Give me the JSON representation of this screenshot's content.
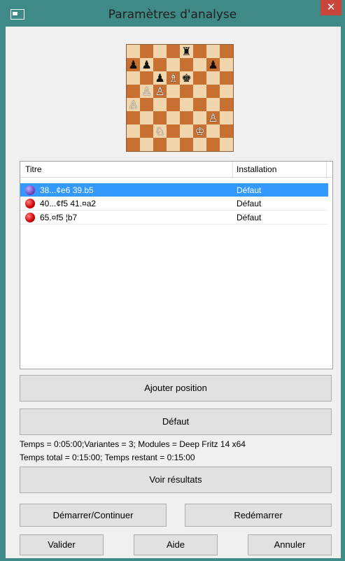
{
  "window": {
    "title": "Paramètres d'analyse",
    "close_glyph": "✕"
  },
  "board": {
    "rows": [
      [
        "",
        "",
        "",
        "",
        "♜",
        "",
        "",
        ""
      ],
      [
        "♟",
        "♟",
        "",
        "",
        "",
        "",
        "♟",
        ""
      ],
      [
        "",
        "",
        "♟",
        "♗",
        "♚",
        "",
        "",
        ""
      ],
      [
        "",
        "♙",
        "♙",
        "",
        "",
        "",
        "",
        ""
      ],
      [
        "♙",
        "",
        "",
        "",
        "",
        "",
        "",
        ""
      ],
      [
        "",
        "",
        "",
        "",
        "",
        "",
        "♙",
        ""
      ],
      [
        "",
        "",
        "♘",
        "",
        "",
        "♔",
        "",
        ""
      ],
      [
        "",
        "",
        "",
        "",
        "",
        "",
        "",
        ""
      ]
    ],
    "white_pieces": [
      "♙",
      "♗",
      "♘",
      "♔"
    ]
  },
  "positions": {
    "columns": [
      "Titre",
      "Installation"
    ],
    "rows": [
      {
        "title": "38...¢e6 39.b5",
        "install": "Défaut",
        "selected": true
      },
      {
        "title": "40...¢f5 41.¤a2",
        "install": "Défaut",
        "selected": false
      },
      {
        "title": "65.¤f5 ¦b7",
        "install": "Défaut",
        "selected": false
      }
    ]
  },
  "buttons": {
    "add_position": "Ajouter position",
    "default": "Défaut",
    "view_results": "Voir résultats",
    "start_continue": "Démarrer/Continuer",
    "restart": "Redémarrer",
    "validate": "Valider",
    "help": "Aide",
    "cancel": "Annuler"
  },
  "info": {
    "line1": "Temps = 0:05:00;Variantes = 3; Modules = Deep Fritz 14 x64",
    "line2": "Temps total = 0:15:00; Temps restant = 0:15:00"
  },
  "colors": {
    "window_frame": "#3f8a87",
    "selection": "#3399ff",
    "board_light": "#f1d5ac",
    "board_dark": "#c86f32"
  }
}
